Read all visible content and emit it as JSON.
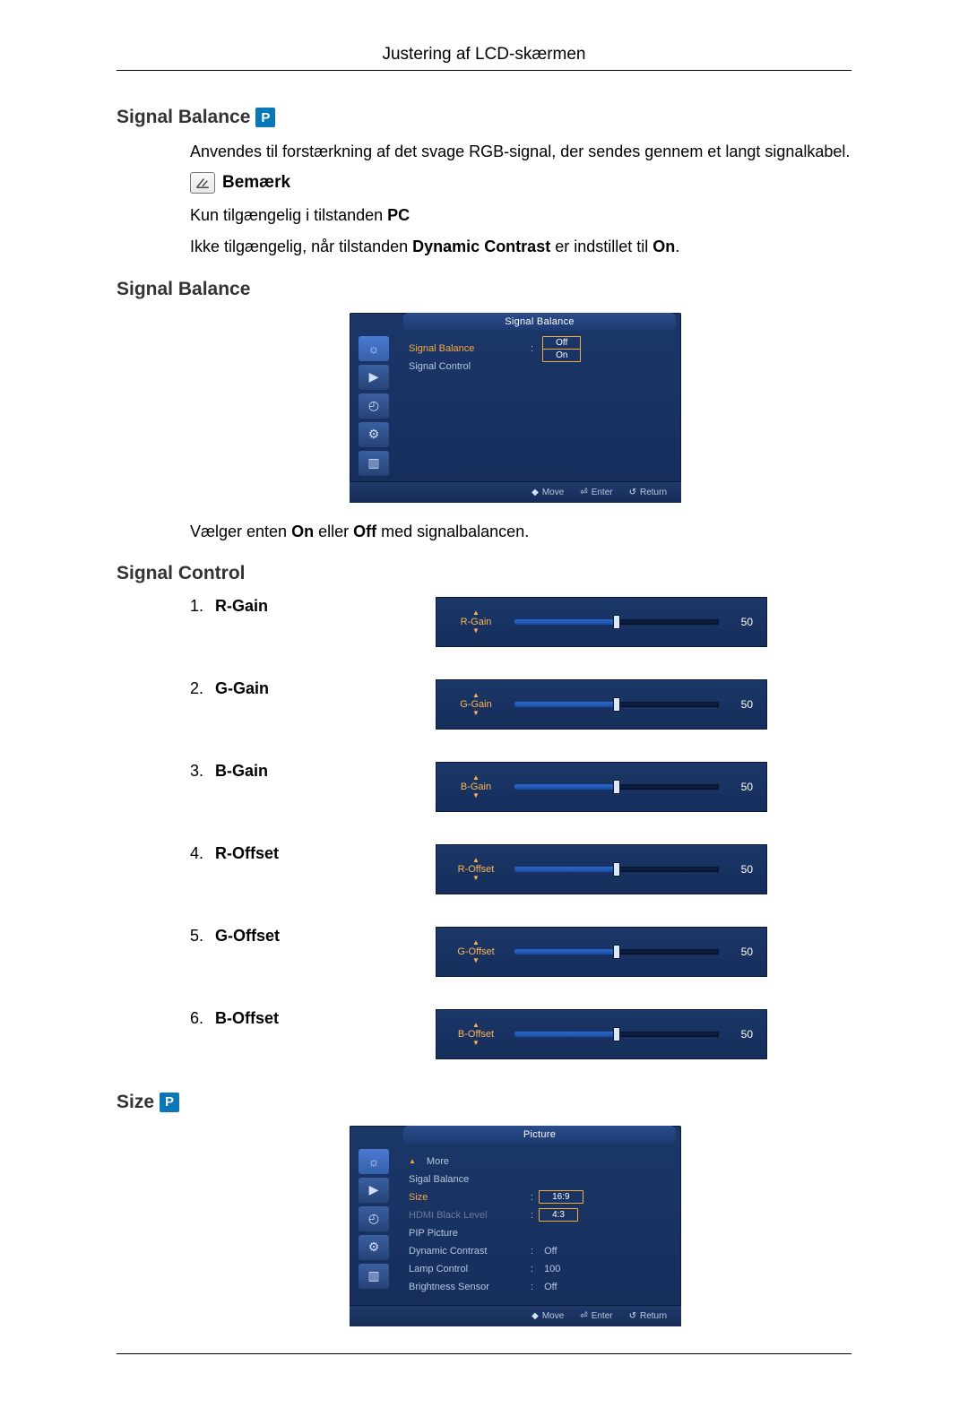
{
  "page_header": "Justering af LCD-skærmen",
  "sections": {
    "signal_balance": {
      "title": "Signal Balance",
      "p_badge": "P",
      "intro": "Anvendes til forstærkning af det svage RGB-signal, der sendes gennem et langt signalkabel.",
      "note_label": "Bemærk",
      "note1_prefix": "Kun tilgængelig i tilstanden ",
      "note1_bold": "PC",
      "note2_prefix": "Ikke tilgængelig, når tilstanden ",
      "note2_bold1": "Dynamic Contrast",
      "note2_mid": " er indstillet til ",
      "note2_bold2": "On",
      "note2_suffix": ".",
      "sub_title": "Signal Balance",
      "osd": {
        "title": "Signal Balance",
        "rows": [
          {
            "label": "Signal Balance",
            "highlighted": true
          },
          {
            "label": "Signal Control",
            "highlighted": false
          }
        ],
        "options": [
          "Off",
          "On"
        ],
        "footer": {
          "move": "Move",
          "enter": "Enter",
          "return": "Return"
        }
      },
      "choose_text_prefix": "Vælger enten ",
      "choose_on": "On",
      "choose_mid": " eller ",
      "choose_off": "Off",
      "choose_suffix": " med signalbalancen."
    },
    "signal_control": {
      "title": "Signal Control",
      "items": [
        {
          "num": "1.",
          "label": "R-Gain",
          "slider_name": "R-Gain",
          "value": "50"
        },
        {
          "num": "2.",
          "label": "G-Gain",
          "slider_name": "G-Gain",
          "value": "50"
        },
        {
          "num": "3.",
          "label": "B-Gain",
          "slider_name": "B-Gain",
          "value": "50"
        },
        {
          "num": "4.",
          "label": "R-Offset",
          "slider_name": "R-Offset",
          "value": "50"
        },
        {
          "num": "5.",
          "label": "G-Offset",
          "slider_name": "G-Offset",
          "value": "50"
        },
        {
          "num": "6.",
          "label": "B-Offset",
          "slider_name": "B-Offset",
          "value": "50"
        }
      ]
    },
    "size": {
      "title": "Size",
      "p_badge": "P",
      "osd": {
        "title": "Picture",
        "more": "More",
        "rows": [
          {
            "label": "Sigal Balance",
            "value": "",
            "style": "plain"
          },
          {
            "label": "Size",
            "value": "16:9",
            "style": "boxsel",
            "orange": true
          },
          {
            "label": "HDMI Black Level",
            "value": "4:3",
            "style": "boxopt",
            "dim": true
          },
          {
            "label": "PIP Picture",
            "value": "",
            "style": "plain"
          },
          {
            "label": "Dynamic Contrast",
            "value": "Off",
            "style": "plain"
          },
          {
            "label": "Lamp Control",
            "value": "100",
            "style": "plain"
          },
          {
            "label": "Brightness Sensor",
            "value": "Off",
            "style": "plain"
          }
        ],
        "footer": {
          "move": "Move",
          "enter": "Enter",
          "return": "Return"
        }
      }
    }
  }
}
